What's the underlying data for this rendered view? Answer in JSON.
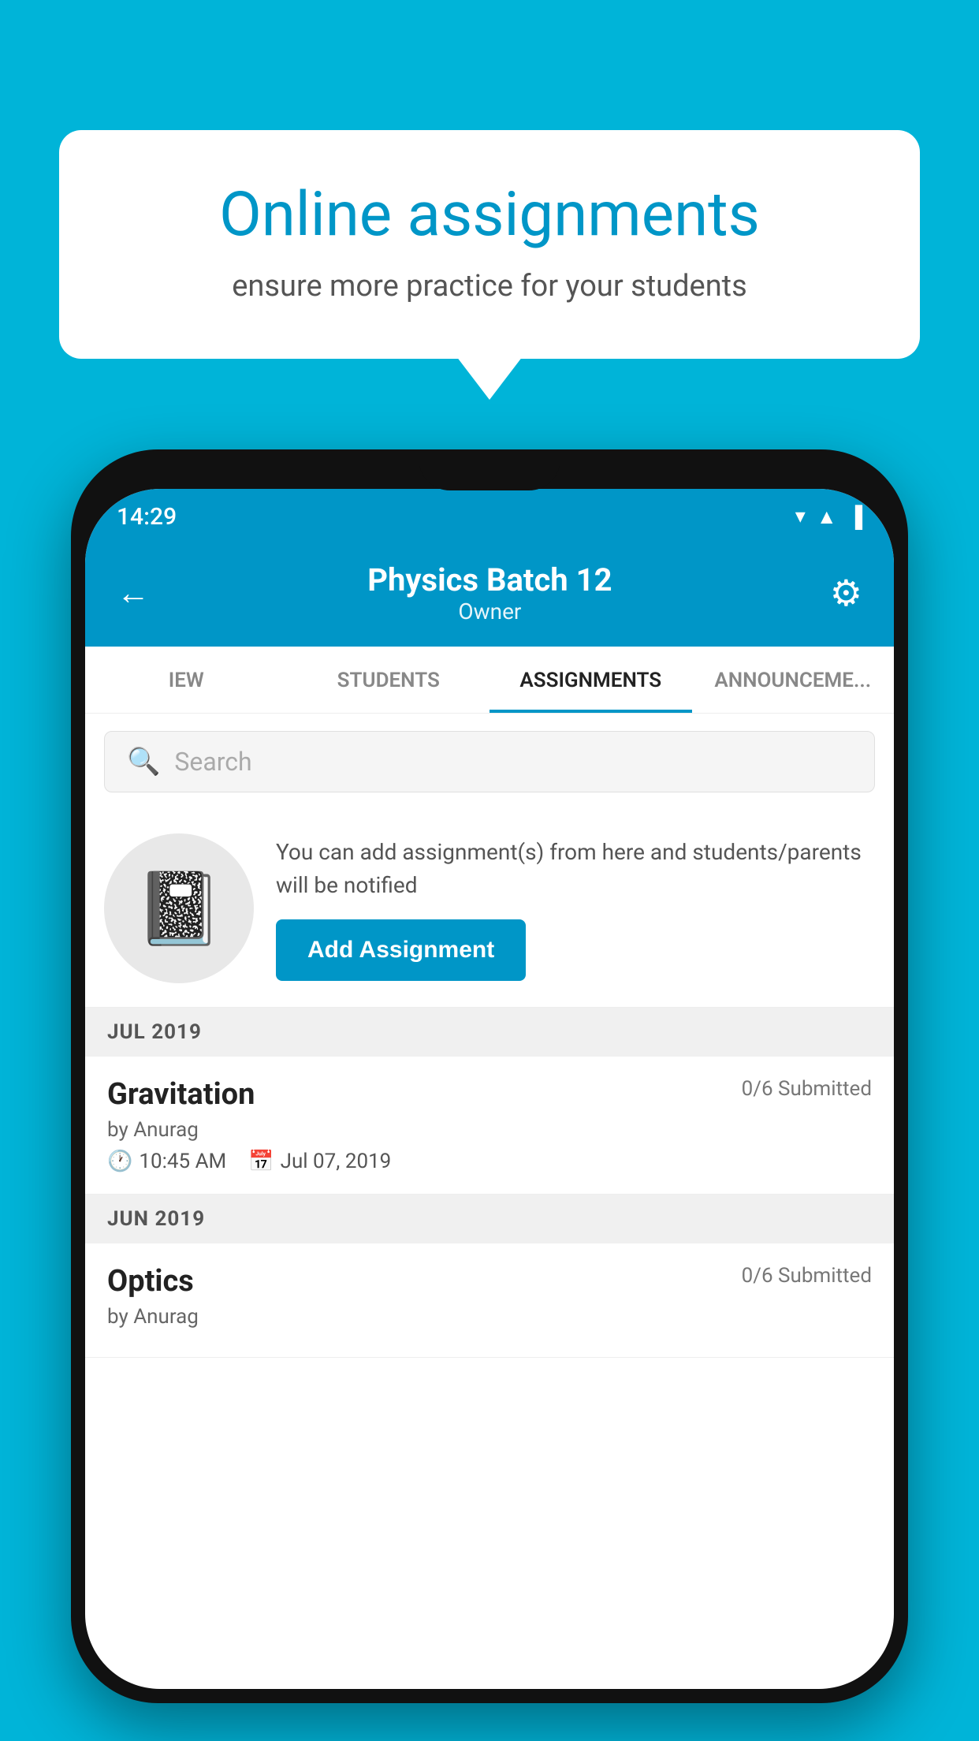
{
  "background_color": "#00b4d8",
  "speech_bubble": {
    "title": "Online assignments",
    "subtitle": "ensure more practice for your students"
  },
  "status_bar": {
    "time": "14:29",
    "icons": [
      "wifi",
      "signal",
      "battery"
    ]
  },
  "app_header": {
    "title": "Physics Batch 12",
    "subtitle": "Owner",
    "back_label": "←",
    "gear_label": "⚙"
  },
  "tabs": [
    {
      "label": "IEW",
      "active": false
    },
    {
      "label": "STUDENTS",
      "active": false
    },
    {
      "label": "ASSIGNMENTS",
      "active": true
    },
    {
      "label": "ANNOUNCEMENTS",
      "active": false
    }
  ],
  "search": {
    "placeholder": "Search"
  },
  "promo": {
    "text": "You can add assignment(s) from here and students/parents will be notified",
    "button_label": "Add Assignment"
  },
  "sections": [
    {
      "header": "JUL 2019",
      "assignments": [
        {
          "name": "Gravitation",
          "submitted": "0/6 Submitted",
          "by": "by Anurag",
          "time": "10:45 AM",
          "date": "Jul 07, 2019"
        }
      ]
    },
    {
      "header": "JUN 2019",
      "assignments": [
        {
          "name": "Optics",
          "submitted": "0/6 Submitted",
          "by": "by Anurag",
          "time": "",
          "date": ""
        }
      ]
    }
  ]
}
